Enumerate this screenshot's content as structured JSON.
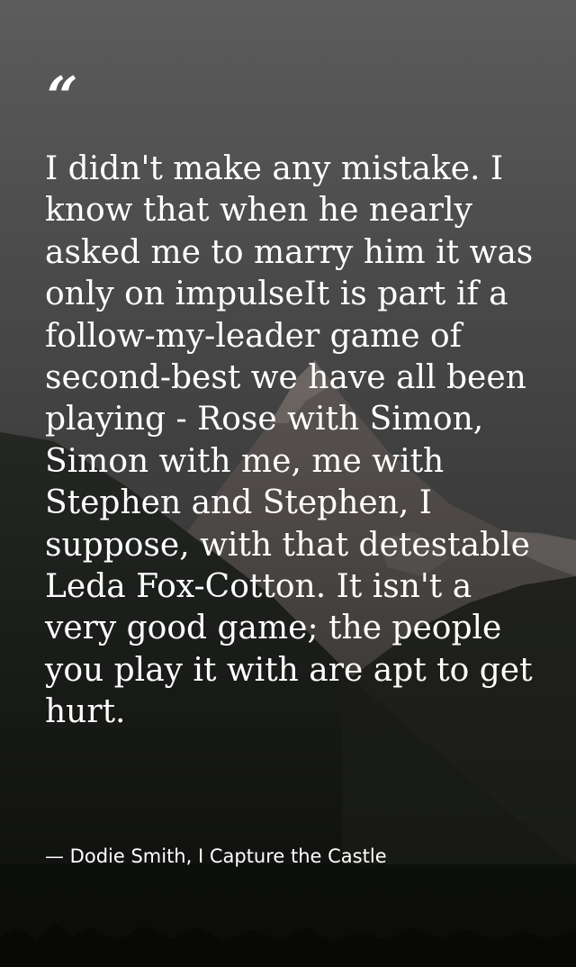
{
  "quote": {
    "mark": "“",
    "text": "I didn't make any mistake. I know that when he nearly asked me to marry him it was only on impulseIt is part if a follow-my-leader game of second-best we have all been playing - Rose with Simon, Simon with me, me with Stephen and Stephen, I suppose, with that detestable Leda Fox-Cotton. It isn't a very good game; the people you play it with are apt to get hurt.",
    "attribution": "— Dodie Smith, I Capture the Castle"
  },
  "background": {
    "image": "mountain-forest-background",
    "colors": {
      "sky_top": "#5e5e5e",
      "sky_bottom": "#454545",
      "mountain": "#6a6766",
      "snow": "#8a8380",
      "forest_dark": "#1c1f1b",
      "forest_mid": "#2a2e28"
    }
  }
}
